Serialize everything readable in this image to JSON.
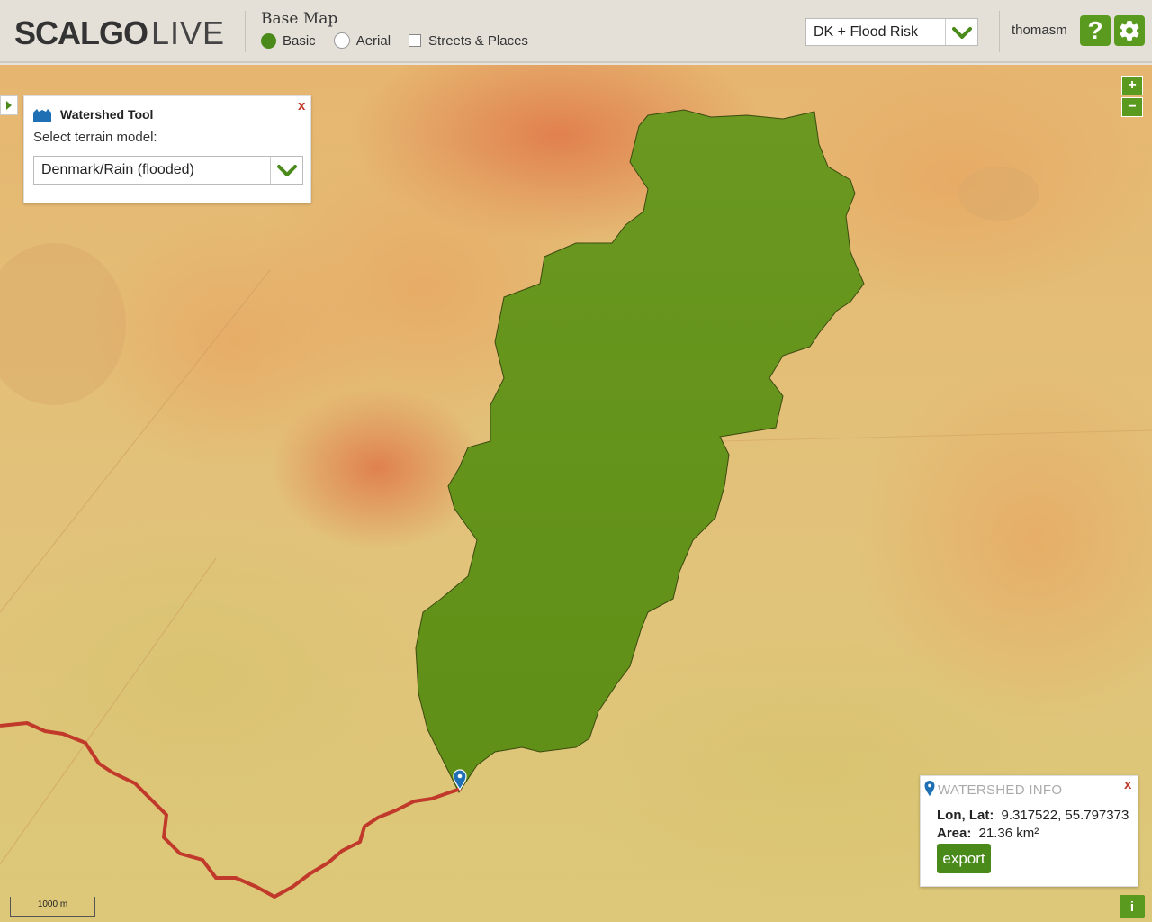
{
  "header": {
    "logo_strong": "SCALGO",
    "logo_light": "LIVE",
    "basemap": {
      "title": "Base Map",
      "options": [
        {
          "label": "Basic",
          "selected": true
        },
        {
          "label": "Aerial",
          "selected": false
        }
      ],
      "streets_label": "Streets & Places",
      "streets_checked": false
    },
    "layer_select": {
      "value": "DK + Flood Risk"
    },
    "username": "thomasm",
    "help_glyph": "?",
    "settings_icon": "gear-icon"
  },
  "map": {
    "zoom_in": "+",
    "zoom_out": "−",
    "scale_label": "1000 m",
    "info_button": "i"
  },
  "tool_panel": {
    "title": "Watershed Tool",
    "close": "x",
    "label": "Select terrain model:",
    "terrain_value": "Denmark/Rain (flooded)"
  },
  "info_panel": {
    "title": "WATERSHED INFO",
    "close": "x",
    "lonlat_label": "Lon, Lat:",
    "lonlat_value": "9.317522, 55.797373",
    "area_label": "Area:",
    "area_value": "21.36 km²",
    "export_label": "export"
  },
  "colors": {
    "accent": "#5a9a1e",
    "watershed_fill": "#5f8f16",
    "river": "#c0392b",
    "close": "#c0392b"
  }
}
